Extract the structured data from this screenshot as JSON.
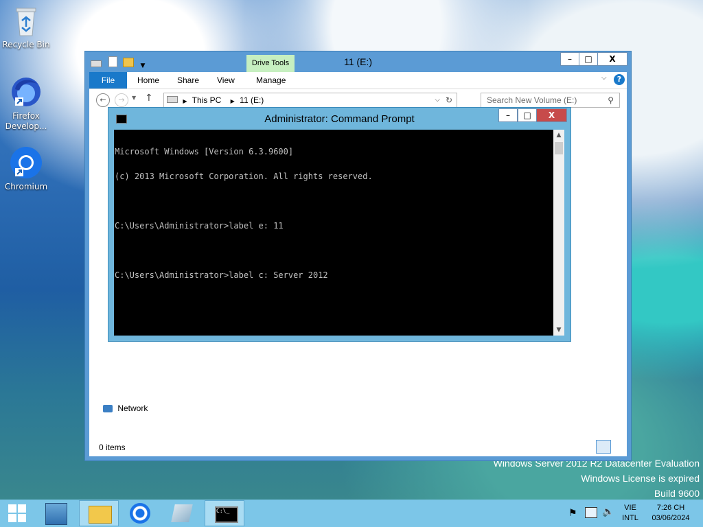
{
  "desktop": {
    "icons": [
      {
        "label": "Recycle Bin"
      },
      {
        "label": "Firefox Develop..."
      },
      {
        "label": "Chromium"
      }
    ],
    "watermark": {
      "line1": "Windows Server 2012 R2 Datacenter Evaluation",
      "line2": "Windows License is expired",
      "line3": "Build 9600"
    }
  },
  "explorer": {
    "title": "11 (E:)",
    "contextual_tab": "Drive Tools",
    "tabs": [
      "File",
      "Home",
      "Share",
      "View",
      "Manage"
    ],
    "breadcrumb": [
      "This PC",
      "11 (E:)"
    ],
    "search_placeholder": "Search New Volume (E:)",
    "nav_items": {
      "network": "Network"
    },
    "status": "0 items",
    "window_buttons": {
      "minimize": "–",
      "maximize": "□",
      "close": "X"
    }
  },
  "cmd": {
    "title": "Administrator: Command Prompt",
    "lines": [
      "Microsoft Windows [Version 6.3.9600]",
      "(c) 2013 Microsoft Corporation. All rights reserved.",
      "",
      "C:\\Users\\Administrator>label e: 11",
      "",
      "C:\\Users\\Administrator>label c: Server 2012"
    ],
    "window_buttons": {
      "minimize": "–",
      "maximize": "□",
      "close": "X"
    }
  },
  "taskbar": {
    "clock": {
      "time": "7:26 CH",
      "date": "03/06/2024"
    },
    "language": {
      "top": "VIE",
      "bottom": "INTL"
    }
  },
  "colors": {
    "explorer_border": "#5b9bd5",
    "cmd_border": "#6fb6dc",
    "close_button": "#c74b4b",
    "taskbar": "#7cc6e8",
    "file_tab": "#1979ca"
  }
}
